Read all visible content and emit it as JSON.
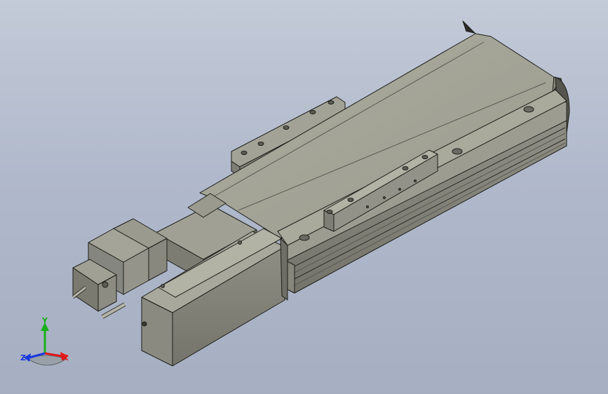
{
  "viewport": {
    "background_top": "#c3cad8",
    "background_bottom": "#a6afc2"
  },
  "model": {
    "body_color": "#9c9c90",
    "top_face_color": "#a6a69a",
    "dark_face_color": "#7c7c72",
    "edge_color": "#1e1e1a"
  },
  "triad": {
    "x_label": "X",
    "y_label": "Y",
    "z_label": "Z",
    "x_color": "#e01818",
    "y_color": "#18b018",
    "z_color": "#1838e0"
  }
}
